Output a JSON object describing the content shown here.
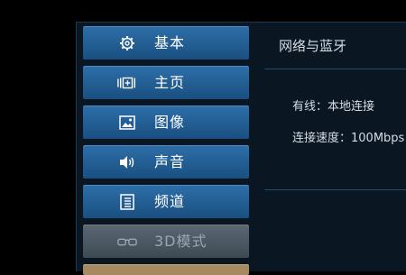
{
  "menu": {
    "items": [
      {
        "label": "基本",
        "icon": "gear-icon"
      },
      {
        "label": "主页",
        "icon": "home-screen-icon"
      },
      {
        "label": "图像",
        "icon": "picture-icon"
      },
      {
        "label": "声音",
        "icon": "speaker-icon"
      },
      {
        "label": "频道",
        "icon": "channel-list-icon"
      },
      {
        "label": "3D模式",
        "icon": "3d-glasses-icon",
        "state": "disabled"
      }
    ]
  },
  "content": {
    "title": "网络与蓝牙",
    "wired_label": "有线：",
    "wired_value": "本地连接",
    "speed_label": "连接速度：",
    "speed_value": "100Mbps"
  },
  "colors": {
    "menu_active": "#2d6ea8",
    "menu_disabled": "#5a6773",
    "menu_partial": "#a88a62",
    "panel_bg": "#0a1622"
  }
}
